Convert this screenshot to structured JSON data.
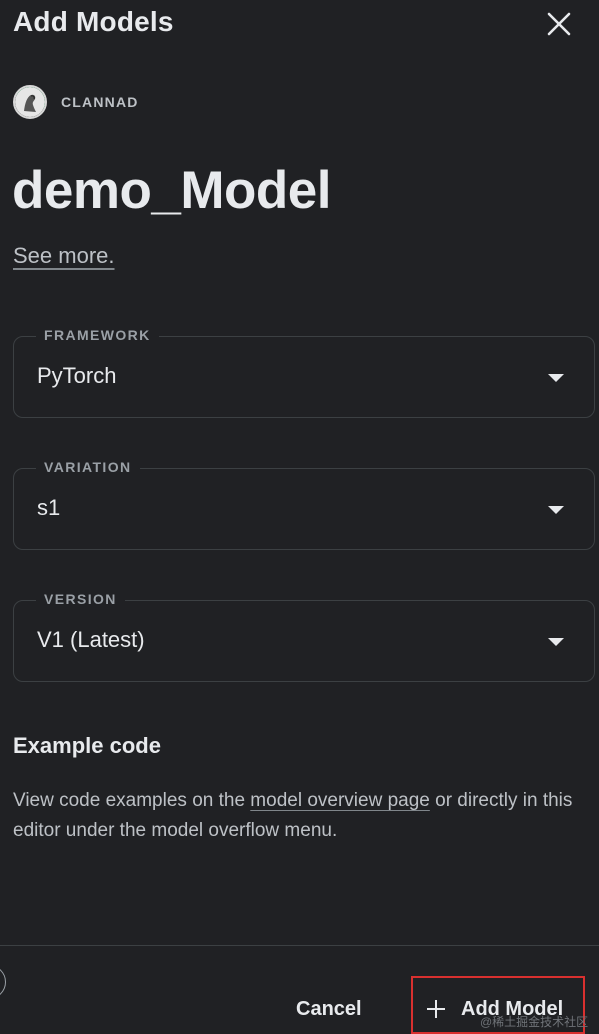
{
  "dialog": {
    "title": "Add Models"
  },
  "owner": {
    "name": "CLANNAD"
  },
  "model": {
    "name": "demo_Model",
    "see_more": "See more."
  },
  "fields": {
    "framework": {
      "label": "FRAMEWORK",
      "value": "PyTorch"
    },
    "variation": {
      "label": "VARIATION",
      "value": "s1"
    },
    "version": {
      "label": "VERSION",
      "value": "V1 (Latest)"
    }
  },
  "example": {
    "title": "Example code",
    "desc_prefix": "View code examples on the ",
    "desc_link": "model overview page",
    "desc_suffix": " or directly in this editor under the model overflow menu."
  },
  "footer": {
    "cancel_label": "Cancel",
    "add_label": "Add Model",
    "highlight_color": "#d9302f"
  },
  "watermark": "@稀土掘金技术社区",
  "icons": {
    "close": "close-icon",
    "caret": "caret-down-icon",
    "plus": "plus-icon",
    "avatar": "owner-avatar"
  },
  "colors": {
    "background": "#202124",
    "text": "#e8eaed",
    "muted": "#bdc1c6",
    "border": "#3c4043",
    "avatar_ring": "#3ddc84"
  }
}
